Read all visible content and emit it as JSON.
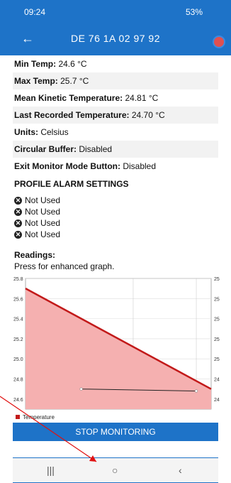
{
  "status": {
    "time": "09:24",
    "right": "53%"
  },
  "appbar": {
    "title": "DE 76 1A 02 97 92"
  },
  "rows": [
    {
      "label": "Min Temp:",
      "value": " 24.6 °C"
    },
    {
      "label": "Max Temp:",
      "value": " 25.7 °C"
    },
    {
      "label": "Mean Kinetic Temperature:",
      "value": " 24.81 °C"
    },
    {
      "label": "Last Recorded Temperature:",
      "value": " 24.70 °C"
    },
    {
      "label": "Units:",
      "value": " Celsius"
    },
    {
      "label": "Circular Buffer:",
      "value": " Disabled"
    },
    {
      "label": "Exit Monitor Mode Button:",
      "value": " Disabled"
    }
  ],
  "profile_alarm_title": "PROFILE ALARM SETTINGS",
  "alarms": [
    "Not Used",
    "Not Used",
    "Not Used",
    "Not Used"
  ],
  "readings": {
    "title": "Readings:",
    "subtitle": "Press for enhanced graph."
  },
  "stop_button": "STOP MONITORING",
  "chart_data": {
    "type": "area",
    "title": "",
    "xlabel": "",
    "ylabel": "",
    "ylim": [
      24.5,
      25.8
    ],
    "yticks": [
      "25.8",
      "25.6",
      "25.4",
      "25.2",
      "25.0",
      "24.8",
      "24.6"
    ],
    "right_ticks": [
      "25",
      "25",
      "25",
      "25",
      "25",
      "24",
      "24"
    ],
    "grid": true,
    "legend": "bottom-left",
    "series": [
      {
        "name": "Temperature",
        "color": "#c21a1a",
        "fill": "#f5b0b0",
        "x": [
          0,
          1
        ],
        "values": [
          25.7,
          24.7
        ]
      }
    ],
    "secondary_line": {
      "x": [
        0.3,
        0.92
      ],
      "values": [
        24.7,
        24.68
      ]
    }
  },
  "colors": {
    "accent": "#1e73c8",
    "series": "#c21a1a",
    "annotation_arrow": "#e01010"
  },
  "icons": {
    "back": "back-arrow-icon",
    "bottom_left": "phone-export-icon",
    "bottom_right": "refresh-icon"
  }
}
